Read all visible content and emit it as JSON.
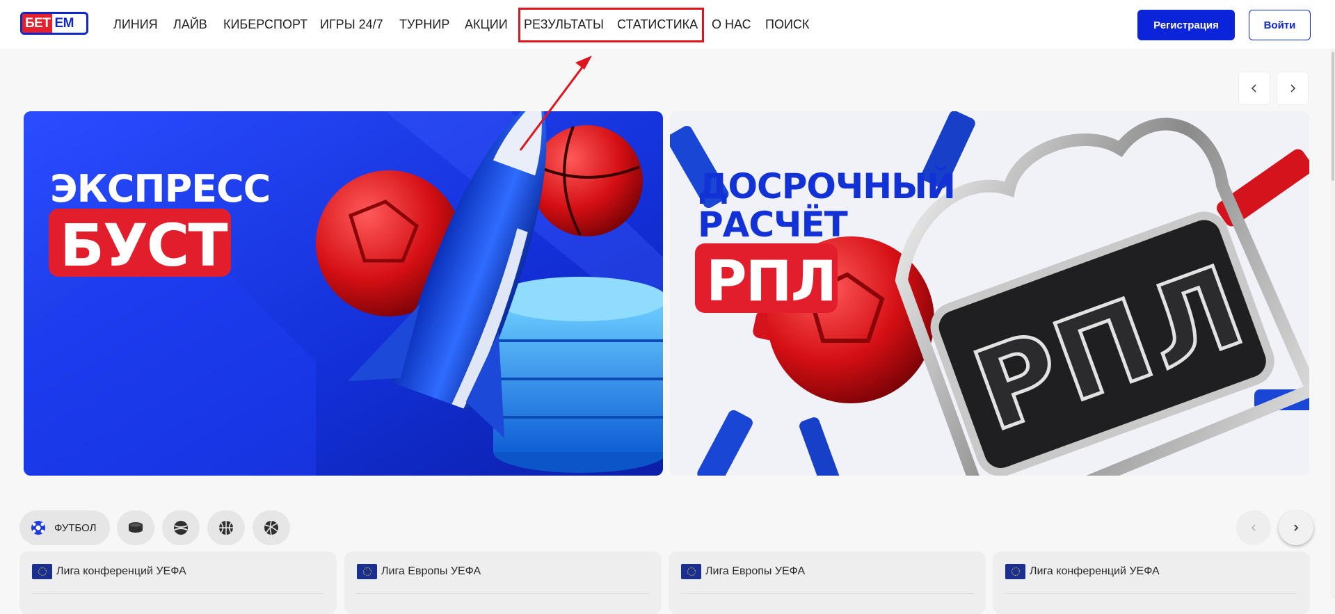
{
  "header": {
    "logo": {
      "part1": "БЕТ",
      "part2": "ЕМ"
    },
    "nav": [
      {
        "id": "liniya",
        "label": "ЛИНИЯ"
      },
      {
        "id": "live",
        "label": "ЛАЙВ"
      },
      {
        "id": "esports",
        "label": "КИБЕРСПОРТ"
      },
      {
        "id": "games",
        "label": "ИГРЫ 24/7"
      },
      {
        "id": "tournament",
        "label": "ТУРНИР"
      },
      {
        "id": "promos",
        "label": "АКЦИИ"
      },
      {
        "id": "results",
        "label": "РЕЗУЛЬТАТЫ"
      },
      {
        "id": "stats",
        "label": "СТАТИСТИКА"
      },
      {
        "id": "about",
        "label": "О НАС"
      },
      {
        "id": "search",
        "label": "ПОИСК"
      }
    ],
    "register_label": "Регистрация",
    "login_label": "Войти"
  },
  "banners": [
    {
      "id": "express-boost",
      "line1": "ЭКСПРЕСС",
      "line2": "БУСТ"
    },
    {
      "id": "rpl",
      "line1": "ДОСРОЧНЫЙ",
      "line2": "РАСЧЁТ",
      "line3": "РПЛ",
      "emblem": "РПЛ"
    }
  ],
  "sports": {
    "active_label": "ФУТБОЛ",
    "items": [
      "football-icon",
      "hockey-icon",
      "tennis-icon",
      "basketball-icon",
      "volleyball-icon"
    ]
  },
  "leagues": [
    {
      "name": "Лига конференций УЕФА"
    },
    {
      "name": "Лига Европы УЕФА"
    },
    {
      "name": "Лига Европы УЕФА"
    },
    {
      "name": "Лига конференций УЕФА"
    }
  ],
  "colors": {
    "brand_blue": "#0c24d9",
    "brand_red": "#e3202b",
    "annotation_red": "#e0141c"
  }
}
